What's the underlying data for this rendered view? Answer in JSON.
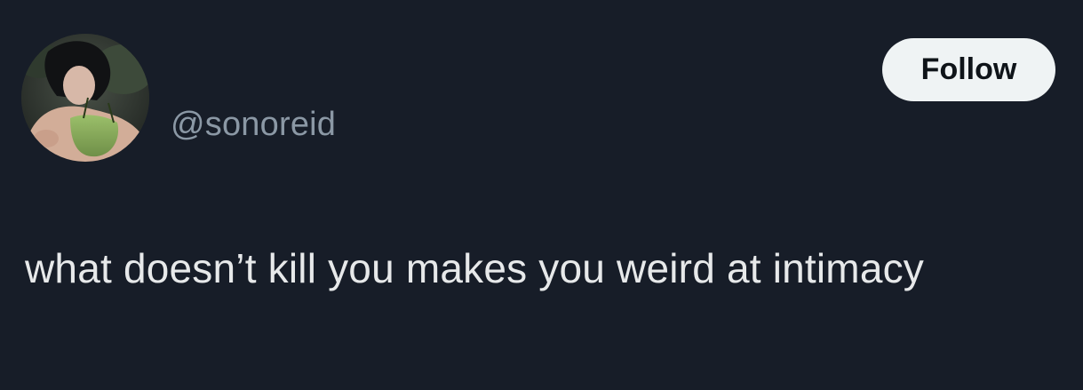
{
  "author": {
    "handle": "@sonoreid",
    "avatar_icon": "profile-photo"
  },
  "actions": {
    "follow_label": "Follow"
  },
  "tweet": {
    "text": "what doesn’t kill you makes you weird at intimacy"
  },
  "colors": {
    "background": "#171d28",
    "text": "#e7e9ea",
    "secondary_text": "#8b98a5",
    "button_bg": "#eff3f4",
    "button_text": "#0f1419"
  }
}
